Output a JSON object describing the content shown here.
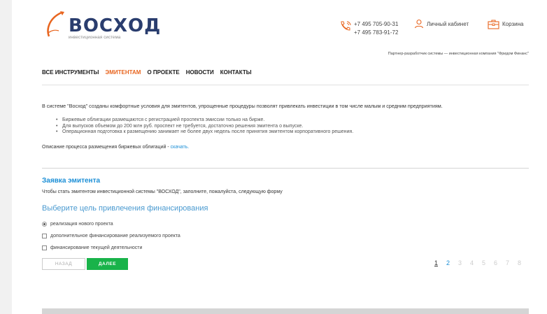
{
  "header": {
    "logo_title": "ВОСХОД",
    "logo_subtitle": "инвестиционная система",
    "phone1": "+7 495 705-90-31",
    "phone2": "+7 495 783-91-72",
    "cabinet_label": "Личный кабинет",
    "cart_label": "Корзина",
    "partner": "Партнер-разработчик системы — инвестиционная компания \"Фридом Финанс\""
  },
  "nav": {
    "items": [
      {
        "label": "ВСЕ ИНСТРУМЕНТЫ"
      },
      {
        "label": "ЭМИТЕНТАМ"
      },
      {
        "label": "О ПРОЕКТЕ"
      },
      {
        "label": "НОВОСТИ"
      },
      {
        "label": "КОНТАКТЫ"
      }
    ],
    "active_index": 1
  },
  "intro": {
    "text": "В системе \"Восход\" созданы комфортные условия для эмитентов, упрощенные процедуры позволят привлекать инвестиции в том числе малым и средним предприятиям.",
    "bullets": [
      "Биржевые облигации размещаются с регистрацией проспекта эмиссии только на бирже.",
      "Для выпусков объемом до 200 млн руб. проспект не требуется, достаточно решения эмитента о выпуске.",
      "Операционная подготовка к размещению занимает не более двух недель после принятия эмитентом корпоративного решения."
    ],
    "desc_text": "Описание процесса размещения биржевых облигаций - ",
    "desc_link": "скачать."
  },
  "form": {
    "title": "Заявка эмитента",
    "text": "Чтобы стать эмитентом инвестиционной системы \"ВОСХОД\", заполните, пожалуйста, следующую форму",
    "goal_title": "Выберите цель привлечения финансирования",
    "options": [
      {
        "label": "реализация нового проекта",
        "type": "radio",
        "checked": true
      },
      {
        "label": "дополнительное финансирование реализуемого проекта",
        "type": "checkbox",
        "checked": false
      },
      {
        "label": "финансирование текущей деятельности",
        "type": "checkbox",
        "checked": false
      }
    ],
    "back_label": "НАЗАД",
    "next_label": "ДАЛЕЕ"
  },
  "pager": {
    "pages": [
      "1",
      "2",
      "3",
      "4",
      "5",
      "6",
      "7",
      "8"
    ],
    "current": 1
  },
  "colors": {
    "accent_orange": "#e8651f",
    "link_blue": "#1a8ed6",
    "button_green": "#19b34a",
    "logo_navy": "#2a3d6e"
  }
}
